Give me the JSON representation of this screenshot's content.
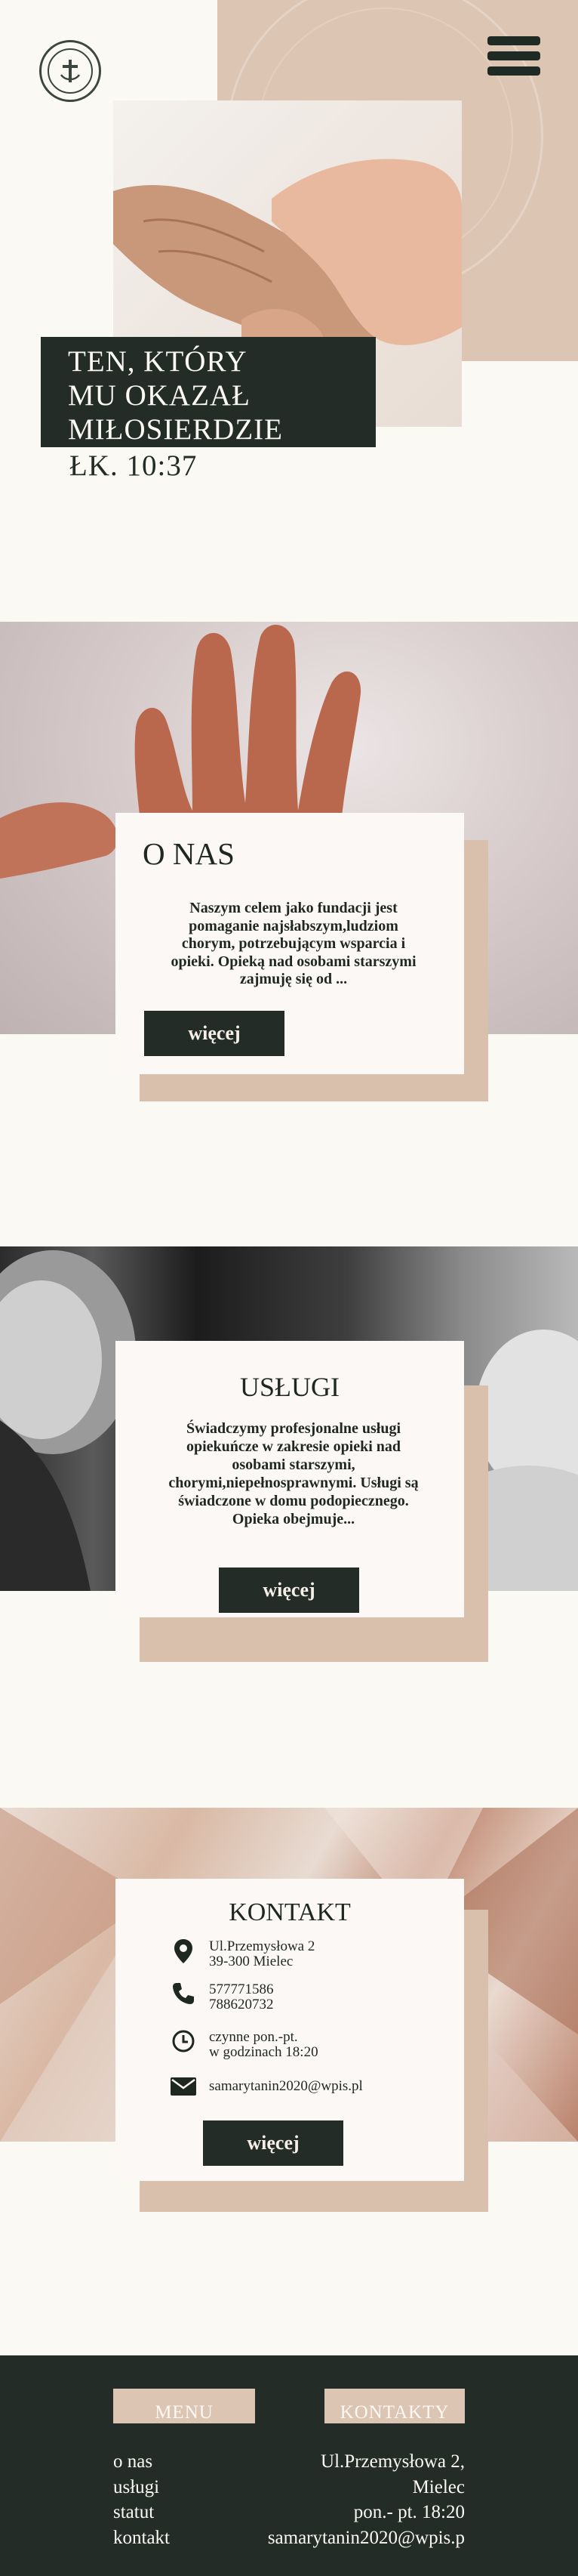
{
  "header": {
    "logo_label": "Samarytanin logo",
    "menu_icon": "hamburger-icon"
  },
  "hero": {
    "title_line1": "TEN, KTÓRY",
    "title_line2": "MU OKAZAŁ",
    "title_line3": "MIŁOSIERDZIE",
    "reference": "ŁK. 10:37"
  },
  "onas": {
    "title": "O NAS",
    "text": "Naszym celem jako fundacji jest pomaganie najsłabszym,ludziom chorym, potrzebującym wsparcia i opieki. Opieką nad osobami starszymi zajmuję się od ...",
    "button": "więcej"
  },
  "uslugi": {
    "title": "USŁUGI",
    "text": "Świadczymy profesjonalne usługi opiekuńcze w zakresie opieki nad osobami starszymi, chorymi,niepełnosprawnymi. Usługi są świadczone w domu podopiecznego. Opieka obejmuje...",
    "button": "więcej"
  },
  "kontakt": {
    "title": "KONTAKT",
    "address_line1": "Ul.Przemysłowa 2",
    "address_line2": "39-300 Mielec",
    "phone1": "577771586",
    "phone2": "788620732",
    "hours_line1": "czynne pon.-pt.",
    "hours_line2": "w godzinach 18:20",
    "email": "samarytanin2020@wpis.pl",
    "button": "więcej",
    "icons": [
      "location-pin-icon",
      "phone-icon",
      "clock-icon",
      "envelope-icon"
    ]
  },
  "footer": {
    "menu_heading": "MENU",
    "contact_heading": "KONTAKTY",
    "menu_items": [
      "o nas",
      "usługi",
      "statut",
      "kontakt"
    ],
    "contact_lines": [
      "Ul.Przemysłowa 2,",
      "Mielec",
      "pon.- pt.  18:20",
      "samarytanin2020@wpis.p"
    ]
  },
  "colors": {
    "dark_green": "#232c26",
    "beige": "#ddc5b3",
    "cream": "#fbf9f4"
  }
}
